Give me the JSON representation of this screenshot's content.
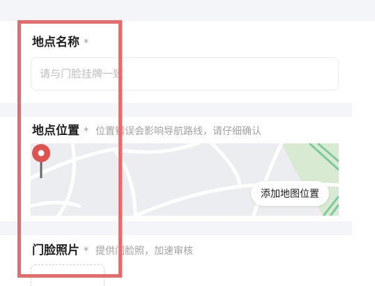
{
  "sections": {
    "name": {
      "title": "地点名称",
      "required_mark": "*",
      "input_placeholder": "请与门脸挂牌一致",
      "input_value": ""
    },
    "location": {
      "title": "地点位置",
      "required_mark": "*",
      "hint": "位置错误会影响导航路线，请仔细确认",
      "add_button_label": "添加地图位置"
    },
    "photo": {
      "title": "门脸照片",
      "required_mark": "*",
      "hint": "提供门脸照，加速审核"
    }
  },
  "colors": {
    "highlight_border": "#e86a6a",
    "pin": "#e0524e",
    "map_green": "#5fbf8f",
    "map_bg": "#ebedf0",
    "separator": "#f3f5f8"
  }
}
